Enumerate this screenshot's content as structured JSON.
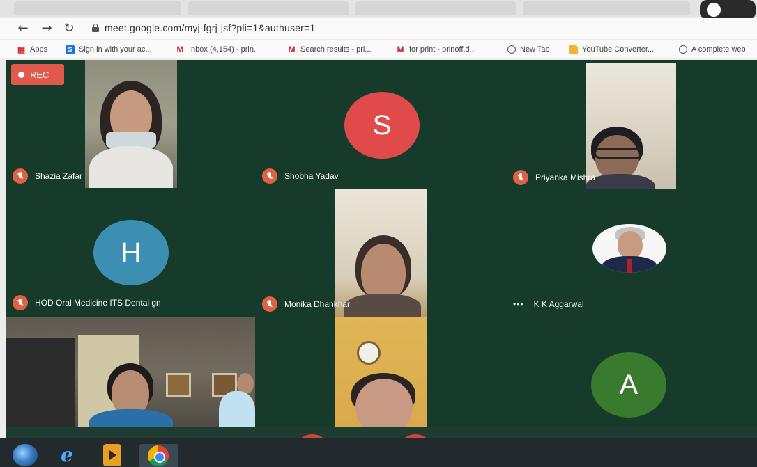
{
  "browser": {
    "url": "meet.google.com/myj-fgrj-jsf?pli=1&authuser=1",
    "bookmarks": [
      {
        "label": "Apps",
        "icon": "apps-grid-icon"
      },
      {
        "label": "Sign in with your ac...",
        "icon": "s-logo-icon"
      },
      {
        "label": "Inbox (4,154) - prin...",
        "icon": "gmail-icon"
      },
      {
        "label": "Search results - pri...",
        "icon": "gmail-icon"
      },
      {
        "label": "for print - prinoff.d...",
        "icon": "gmail-icon"
      },
      {
        "label": "New Tab",
        "icon": "globe-icon"
      },
      {
        "label": "YouTube Converter...",
        "icon": "folder-icon"
      },
      {
        "label": "A complete web",
        "icon": "globe-icon"
      }
    ]
  },
  "meet": {
    "rec_label": "REC",
    "participants": [
      {
        "name": "Shazia Zafar",
        "muted": true
      },
      {
        "name": "Shobha Yadav",
        "muted": true,
        "avatar_letter": "S",
        "avatar_color": "#e04a4a"
      },
      {
        "name": "Priyanka Mishra",
        "muted": true
      },
      {
        "name": "HOD Oral Medicine ITS Dental gn",
        "muted": true,
        "avatar_letter": "H",
        "avatar_color": "#3c8fb2"
      },
      {
        "name": "Monika Dhankhar",
        "muted": true
      },
      {
        "name": "K K Aggarwal",
        "muted": false
      },
      {
        "name": "",
        "muted": false
      },
      {
        "name": "",
        "muted": false
      },
      {
        "name": "",
        "muted": false,
        "avatar_letter": "A",
        "avatar_color": "#3a7a2e"
      }
    ]
  },
  "colors": {
    "meet_background": "#173b2a",
    "mute_icon": "#e06145",
    "rec_badge": "#e05a4b"
  }
}
